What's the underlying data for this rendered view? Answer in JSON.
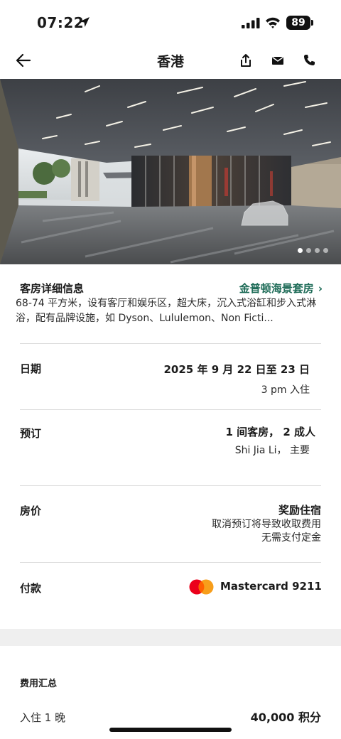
{
  "status": {
    "time": "07:22",
    "battery": "89"
  },
  "header": {
    "title": "香港",
    "back_icon": "arrow-left-icon",
    "icons": [
      "share-icon",
      "mail-icon",
      "phone-icon"
    ]
  },
  "hero": {
    "image_count": 4,
    "active_index": 0
  },
  "room": {
    "label": "客房详细信息",
    "link": "金普顿海景套房",
    "description": "68-74 平方米，设有客厅和娱乐区，超大床，沉入式浴缸和步入式淋浴，配有品牌设施，如 Dyson、Lululemon、Non Ficti..."
  },
  "dates": {
    "label": "日期",
    "range": "2025 年 9 月 22 日至 23 日",
    "checkin": "3 pm 入住"
  },
  "booking": {
    "label": "预订",
    "rooms": "1 间客房， 2 成人",
    "guest": "Shi Jia Li， 主要"
  },
  "rate": {
    "label": "房价",
    "type": "奖励住宿",
    "cancel": "取消预订将导致收取费用",
    "deposit": "无需支付定金"
  },
  "payment": {
    "label": "付款",
    "card": "Mastercard 9211",
    "card_icon": "mastercard-icon"
  },
  "summary": {
    "title": "费用汇总",
    "row_label": "入住 1 晚",
    "row_value": "40,000 积分"
  },
  "colors": {
    "accent": "#1d6b57",
    "divider": "#dcdcdc",
    "band": "#efefef"
  }
}
